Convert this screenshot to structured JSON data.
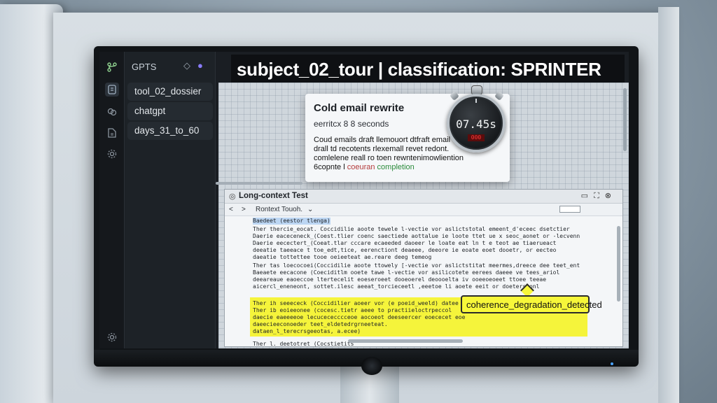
{
  "title_overlay": "subject_02_tour | classification: SPRINTER",
  "sidebar": {
    "header": "GPTS",
    "items": [
      {
        "label": "tool_02_dossier"
      },
      {
        "label": "chatgpt"
      },
      {
        "label": "days_31_to_60"
      }
    ]
  },
  "popup": {
    "title": "Cold email rewrite",
    "meta": "eerritcx 8 8 seconds",
    "body_lines": [
      "Coud emails draft llemouort dtfraft email",
      "drall td recotents rlexemall revet redont.",
      "comlelene reall ro toen rewntenimowliention"
    ],
    "footer_prefix": "6copnte l",
    "footer_red": "coeuran",
    "footer_green": "completion"
  },
  "stopwatch": {
    "time": "07.45s",
    "red_display": "000"
  },
  "editor": {
    "title": "Long-context Test",
    "toolbar_label": "Rontext Touoh.",
    "lines": [
      "Baedeet (eestor tlenga)",
      "Ther thercie_eocat. Coccidilie aoote tewele l-vectie vor aslictstotal emeent_d'eceec dsetctier",
      "Daerie eaceceneck_(Coest.tlier coenc saectiede aottalue ie loote ttet ue x seoc_aonet or -lecvenn",
      "Daerie eecectert_(Coeat.tlar cccare ecaeeded daoeer le loate eat ln t e teot ae tiaerueact",
      "deeatie taeeace t toe_edt,tice, eerenctiont deaeee, deeore ie eoate eoet dooetr, or eecteo",
      "daeatie tottettee tooe oeieeteat ae.reare deeg temeog",
      "",
      "Ther tas loecocoei(Coccidilie aoote ttowely [-vectie vor aslictstitat meermes,dreece dee teet_ent",
      "Baeaete eecacone (Coeciditlm ooete tawe l-vectie vor asilicotete eerees daeee ve tees_ariol",
      "deeareaue eaoeccoe ltertecelit eoeseroeet dooeoerel deoooelta iv ooeeoeoeet ttoee teeae",
      "aicercl_eneneont, sottet.ilesc aeeat_torcieceetl ,eeetoe li aoete eeit or doeterseonl",
      "",
      "Ther ih seeececk (Coccidilier aoeer vor (e poeid_weeld) datee",
      "Ther ib eoieeonee (cocesc.tietr aeee to practiieloctrpeccol",
      "daecie eaeeeeoe lecucececccceoe aocoeot deeseercer eoececet eoe",
      "daeecieeconoeder teet_eldetedrgrneeteat.",
      "dataen_l_terecrsgeeotas, a.ecee)",
      "",
      "Ther l. deetotret (Cocstietits"
    ]
  },
  "callout": "coherence_degradation_detected",
  "colors": {
    "highlight": "#f4f32a",
    "callout_bg": "#f7f73a",
    "sidebar_bg": "#1d2227",
    "screen_bg": "#1a1e23"
  },
  "icons": [
    "branch-icon",
    "document-icon",
    "brain-icon",
    "file-icon",
    "settings-icon",
    "diamond-icon",
    "openai-orb-icon",
    "back-arrow-icon",
    "forward-arrow-icon",
    "minimize-icon",
    "maximize-icon",
    "close-icon"
  ]
}
